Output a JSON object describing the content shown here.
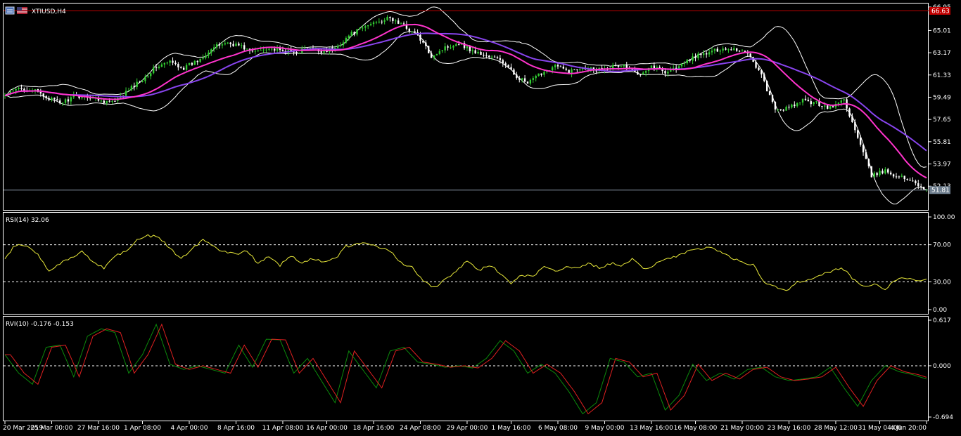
{
  "window": {
    "symbol_label": "XTIUSD,H4"
  },
  "panels": {
    "rsi_label": "RSI(14) 32.06",
    "rvi_label": "RVI(10) -0.176 -0.153"
  },
  "colors": {
    "background": "#000000",
    "frame": "#ffffff",
    "bull_candle": "#32cd32",
    "bear_candle": "#ffffff",
    "bollinger": "#ffffff",
    "ma_fast": "#ff33cc",
    "ma_slow": "#8844ee",
    "rsi_line": "#e8e83a",
    "rvi_main": "#0b8a0b",
    "rvi_signal": "#e02020",
    "hline_red": "#c00000",
    "hline_bid": "#8a96a8",
    "price_tag_red": "#c00000",
    "price_tag_bid": "#708090"
  },
  "chart_data": [
    {
      "type": "candlestick",
      "symbol": "XTIUSD",
      "timeframe": "H4",
      "y_ticks": [
        "66.95",
        "65.01",
        "63.17",
        "61.33",
        "59.49",
        "57.65",
        "55.81",
        "53.97",
        "52.13"
      ],
      "price_tags": {
        "high_line": "66.63",
        "bid": "51.81"
      },
      "ylim": [
        50.75,
        66.95
      ],
      "x_labels": [
        "20 Mar 2019",
        "25 Mar 00:00",
        "27 Mar 16:00",
        "1 Apr 08:00",
        "4 Apr 00:00",
        "8 Apr 16:00",
        "11 Apr 08:00",
        "16 Apr 00:00",
        "18 Apr 16:00",
        "24 Apr 08:00",
        "29 Apr 00:00",
        "1 May 16:00",
        "6 May 08:00",
        "9 May 00:00",
        "13 May 16:00",
        "16 May 08:00",
        "21 May 00:00",
        "23 May 16:00",
        "28 May 12:00",
        "31 May 04:00",
        "4 Jun 20:00"
      ],
      "close_path": [
        [
          0,
          59.6
        ],
        [
          5,
          60.2
        ],
        [
          10,
          60.1
        ],
        [
          15,
          59.5
        ],
        [
          20,
          59.0
        ],
        [
          25,
          59.5
        ],
        [
          30,
          59.6
        ],
        [
          35,
          59.2
        ],
        [
          40,
          59.1
        ],
        [
          45,
          60.1
        ],
        [
          50,
          61.0
        ],
        [
          55,
          62.0
        ],
        [
          60,
          62.4
        ],
        [
          65,
          61.9
        ],
        [
          70,
          62.5
        ],
        [
          75,
          63.5
        ],
        [
          80,
          64.0
        ],
        [
          85,
          63.8
        ],
        [
          90,
          63.2
        ],
        [
          95,
          63.6
        ],
        [
          100,
          63.3
        ],
        [
          105,
          63.2
        ],
        [
          110,
          63.5
        ],
        [
          115,
          63.3
        ],
        [
          120,
          63.5
        ],
        [
          125,
          64.6
        ],
        [
          130,
          65.2
        ],
        [
          135,
          65.8
        ],
        [
          140,
          66.0
        ],
        [
          145,
          65.4
        ],
        [
          150,
          64.6
        ],
        [
          155,
          62.9
        ],
        [
          160,
          63.6
        ],
        [
          165,
          64.0
        ],
        [
          170,
          63.3
        ],
        [
          175,
          62.9
        ],
        [
          180,
          62.6
        ],
        [
          185,
          61.4
        ],
        [
          190,
          60.6
        ],
        [
          195,
          61.5
        ],
        [
          200,
          62.1
        ],
        [
          205,
          61.6
        ],
        [
          210,
          62.0
        ],
        [
          215,
          61.8
        ],
        [
          220,
          62.0
        ],
        [
          225,
          62.1
        ],
        [
          230,
          61.4
        ],
        [
          235,
          62.1
        ],
        [
          240,
          61.6
        ],
        [
          245,
          62.0
        ],
        [
          250,
          62.8
        ],
        [
          255,
          63.1
        ],
        [
          260,
          63.5
        ],
        [
          265,
          63.5
        ],
        [
          270,
          63.2
        ],
        [
          275,
          61.3
        ],
        [
          280,
          58.4
        ],
        [
          285,
          58.6
        ],
        [
          290,
          59.2
        ],
        [
          295,
          59.0
        ],
        [
          300,
          58.6
        ],
        [
          305,
          59.3
        ],
        [
          310,
          56.1
        ],
        [
          315,
          53.0
        ],
        [
          320,
          53.4
        ],
        [
          325,
          52.9
        ],
        [
          330,
          52.6
        ],
        [
          335,
          51.8
        ]
      ],
      "bars": 336
    },
    {
      "type": "line",
      "name": "RSI(14)",
      "y_ticks": [
        "100.00",
        "70.00",
        "30.00",
        "0.00"
      ],
      "levels": [
        70,
        30
      ],
      "ylim": [
        0,
        100
      ],
      "path": [
        [
          0,
          56
        ],
        [
          4,
          70
        ],
        [
          8,
          68
        ],
        [
          12,
          60
        ],
        [
          16,
          42
        ],
        [
          20,
          50
        ],
        [
          24,
          55
        ],
        [
          28,
          62
        ],
        [
          32,
          52
        ],
        [
          36,
          45
        ],
        [
          40,
          58
        ],
        [
          44,
          63
        ],
        [
          48,
          75
        ],
        [
          52,
          80
        ],
        [
          56,
          78
        ],
        [
          60,
          66
        ],
        [
          64,
          55
        ],
        [
          68,
          66
        ],
        [
          72,
          75
        ],
        [
          76,
          68
        ],
        [
          80,
          62
        ],
        [
          84,
          60
        ],
        [
          88,
          64
        ],
        [
          92,
          50
        ],
        [
          96,
          58
        ],
        [
          100,
          48
        ],
        [
          104,
          58
        ],
        [
          108,
          50
        ],
        [
          112,
          55
        ],
        [
          116,
          52
        ],
        [
          120,
          55
        ],
        [
          124,
          68
        ],
        [
          128,
          70
        ],
        [
          132,
          72
        ],
        [
          136,
          68
        ],
        [
          140,
          64
        ],
        [
          144,
          50
        ],
        [
          148,
          46
        ],
        [
          152,
          30
        ],
        [
          156,
          24
        ],
        [
          160,
          32
        ],
        [
          164,
          42
        ],
        [
          168,
          52
        ],
        [
          172,
          42
        ],
        [
          176,
          48
        ],
        [
          180,
          40
        ],
        [
          184,
          28
        ],
        [
          188,
          38
        ],
        [
          192,
          35
        ],
        [
          196,
          48
        ],
        [
          200,
          42
        ],
        [
          204,
          45
        ],
        [
          208,
          45
        ],
        [
          212,
          50
        ],
        [
          216,
          45
        ],
        [
          220,
          50
        ],
        [
          224,
          48
        ],
        [
          228,
          55
        ],
        [
          232,
          44
        ],
        [
          236,
          48
        ],
        [
          240,
          55
        ],
        [
          244,
          58
        ],
        [
          248,
          62
        ],
        [
          252,
          65
        ],
        [
          256,
          68
        ],
        [
          260,
          62
        ],
        [
          264,
          56
        ],
        [
          268,
          52
        ],
        [
          272,
          48
        ],
        [
          276,
          30
        ],
        [
          280,
          25
        ],
        [
          284,
          20
        ],
        [
          288,
          30
        ],
        [
          292,
          32
        ],
        [
          296,
          38
        ],
        [
          300,
          40
        ],
        [
          304,
          46
        ],
        [
          308,
          34
        ],
        [
          312,
          25
        ],
        [
          316,
          28
        ],
        [
          320,
          22
        ],
        [
          324,
          32
        ],
        [
          328,
          34
        ],
        [
          332,
          30
        ],
        [
          335,
          32
        ]
      ]
    },
    {
      "type": "line",
      "name": "RVI(10)",
      "y_ticks": [
        "0.617",
        "0.000",
        "-0.694"
      ],
      "levels": [
        0
      ],
      "ylim": [
        -0.694,
        0.617
      ],
      "main_path": [
        [
          0,
          0.15
        ],
        [
          5,
          -0.1
        ],
        [
          10,
          -0.25
        ],
        [
          15,
          0.25
        ],
        [
          20,
          0.28
        ],
        [
          25,
          -0.15
        ],
        [
          30,
          0.4
        ],
        [
          35,
          0.5
        ],
        [
          40,
          0.45
        ],
        [
          45,
          -0.1
        ],
        [
          50,
          0.15
        ],
        [
          55,
          0.56
        ],
        [
          60,
          0.02
        ],
        [
          65,
          -0.05
        ],
        [
          70,
          0.0
        ],
        [
          75,
          -0.05
        ],
        [
          80,
          -0.1
        ],
        [
          85,
          0.28
        ],
        [
          90,
          -0.02
        ],
        [
          95,
          0.36
        ],
        [
          100,
          0.35
        ],
        [
          105,
          -0.1
        ],
        [
          110,
          0.1
        ],
        [
          115,
          -0.2
        ],
        [
          120,
          -0.5
        ],
        [
          125,
          0.2
        ],
        [
          130,
          -0.05
        ],
        [
          135,
          -0.3
        ],
        [
          140,
          0.2
        ],
        [
          145,
          0.25
        ],
        [
          150,
          0.05
        ],
        [
          155,
          0.02
        ],
        [
          160,
          -0.02
        ],
        [
          165,
          0.0
        ],
        [
          170,
          -0.03
        ],
        [
          175,
          0.1
        ],
        [
          180,
          0.34
        ],
        [
          185,
          0.2
        ],
        [
          190,
          -0.1
        ],
        [
          195,
          0.02
        ],
        [
          200,
          -0.1
        ],
        [
          205,
          -0.35
        ],
        [
          210,
          -0.65
        ],
        [
          215,
          -0.5
        ],
        [
          220,
          0.1
        ],
        [
          225,
          0.05
        ],
        [
          230,
          -0.15
        ],
        [
          235,
          -0.1
        ],
        [
          240,
          -0.6
        ],
        [
          245,
          -0.4
        ],
        [
          250,
          0.02
        ],
        [
          255,
          -0.2
        ],
        [
          260,
          -0.1
        ],
        [
          265,
          -0.18
        ],
        [
          270,
          -0.05
        ],
        [
          275,
          -0.02
        ],
        [
          280,
          -0.15
        ],
        [
          285,
          -0.2
        ],
        [
          290,
          -0.18
        ],
        [
          295,
          -0.15
        ],
        [
          300,
          -0.02
        ],
        [
          305,
          -0.3
        ],
        [
          310,
          -0.55
        ],
        [
          315,
          -0.2
        ],
        [
          320,
          0.0
        ],
        [
          325,
          -0.08
        ],
        [
          330,
          -0.12
        ],
        [
          335,
          -0.18
        ]
      ],
      "signal_lag_bars": 2
    }
  ]
}
